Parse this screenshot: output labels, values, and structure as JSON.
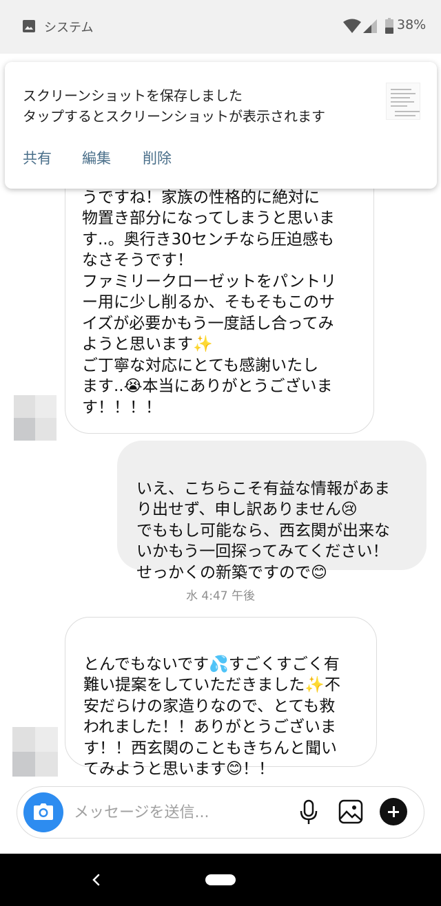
{
  "status_bar": {
    "app_label": "システム",
    "battery": "38%"
  },
  "notification": {
    "title": "スクリーンショットを保存しました",
    "body": "タップするとスクリーンショットが表示されます",
    "actions": [
      "共有",
      "編集",
      "削除"
    ]
  },
  "messages": [
    {
      "direction": "incoming",
      "text": "うですね！家族の性格的に絶対に\n物置き部分になってしまうと思いま\nす..。奥行き30センチなら圧迫感も\nなさそうです！\nファミリークローゼットをパントリ\nー用に少し削るか、そもそもこのサ\nイズが必要かもう一度話し合ってみ\nようと思います✨\nご丁寧な対応にとても感謝いたし\nます..😭本当にありがとうございま\nす！！！！"
    },
    {
      "direction": "outgoing",
      "text": "いえ、こちらこそ有益な情報があま\nり出せず、申し訳ありません😢\nでももし可能なら、西玄関が出来な\nいかもう一回探ってみてください！\nせっかくの新築ですので😊"
    },
    {
      "direction": "incoming",
      "text": "とんでもないです💦すごくすごく有\n難い提案をしていただきました✨不\n安だらけの家造りなので、とても救\nわれました！！ありがとうございま\nす！！西玄関のこともきちんと聞い\nてみようと思います😊！！"
    }
  ],
  "timestamp": "水 4:47 午後",
  "composer": {
    "placeholder": "メッセージを送信..."
  },
  "colors": {
    "camera_button": "#2d8cf0",
    "notification_action": "#4a6f8a",
    "outgoing_bubble": "#efefef"
  },
  "icons": [
    "image-icon",
    "wifi-icon",
    "cell-signal-icon",
    "battery-icon",
    "camera-icon",
    "microphone-icon",
    "gallery-icon",
    "plus-icon",
    "back-icon",
    "home-icon"
  ]
}
